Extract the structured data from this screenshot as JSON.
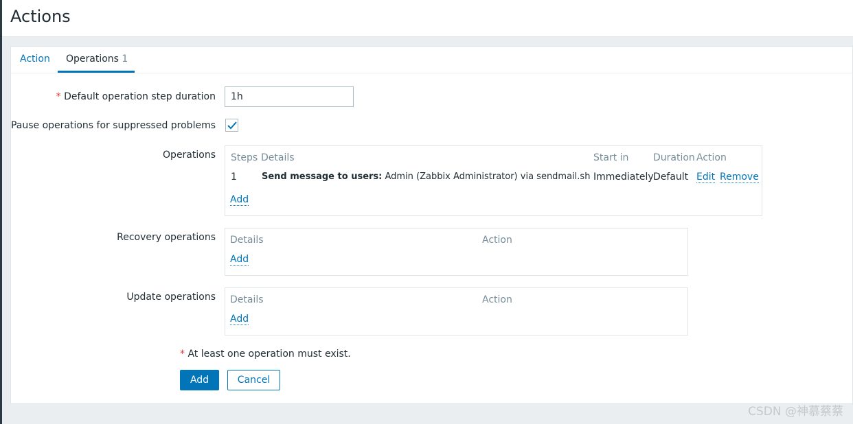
{
  "page": {
    "title": "Actions"
  },
  "tabs": [
    {
      "label": "Action",
      "count": ""
    },
    {
      "label": "Operations",
      "count": "1"
    }
  ],
  "form": {
    "step_duration": {
      "required_mark": "*",
      "label": "Default operation step duration",
      "value": "1h"
    },
    "pause": {
      "label": "Pause operations for suppressed problems",
      "checked": true
    },
    "operations": {
      "label": "Operations",
      "headers": {
        "steps": "Steps",
        "details": "Details",
        "start_in": "Start in",
        "duration": "Duration",
        "action": "Action"
      },
      "rows": [
        {
          "steps": "1",
          "details_bold": "Send message to users:",
          "details_rest": " Admin (Zabbix Administrator) via sendmail.sh",
          "start_in": "Immediately",
          "duration": "Default",
          "edit": "Edit",
          "remove": "Remove"
        }
      ],
      "add": "Add"
    },
    "recovery": {
      "label": "Recovery operations",
      "headers": {
        "details": "Details",
        "action": "Action"
      },
      "add": "Add"
    },
    "update": {
      "label": "Update operations",
      "headers": {
        "details": "Details",
        "action": "Action"
      },
      "add": "Add"
    },
    "warning": {
      "required_mark": "*",
      "text": "At least one operation must exist."
    },
    "buttons": {
      "add": "Add",
      "cancel": "Cancel"
    }
  },
  "watermark": "CSDN @神慕蔡蔡",
  "colors": {
    "accent": "#0275b8",
    "required": "#e33734",
    "background": "#ebeef0"
  }
}
